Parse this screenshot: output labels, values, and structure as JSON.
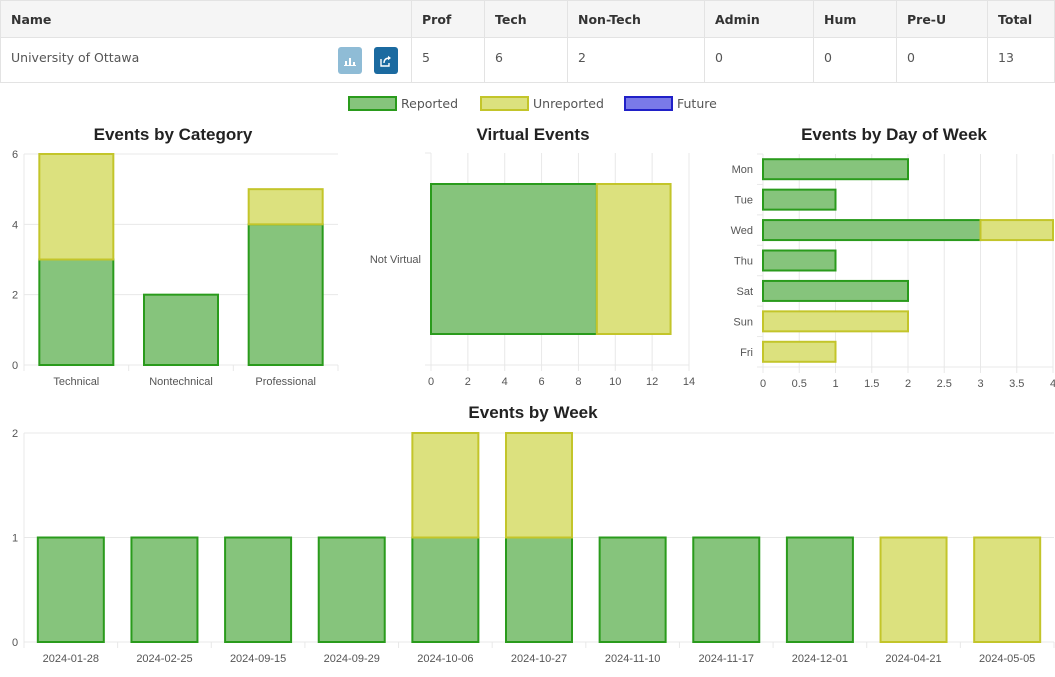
{
  "table": {
    "headers": [
      "Name",
      "Prof",
      "Tech",
      "Non-Tech",
      "Admin",
      "Hum",
      "Pre-U",
      "Total"
    ],
    "row": {
      "name": "University of Ottawa",
      "values": [
        "5",
        "6",
        "2",
        "0",
        "0",
        "0",
        "13"
      ]
    },
    "buttons": {
      "chart_icon": "bar-chart-icon",
      "share_icon": "share-icon"
    }
  },
  "legend": [
    {
      "label": "Reported",
      "fill": "#86c47c",
      "stroke": "#2a9b1c"
    },
    {
      "label": "Unreported",
      "fill": "#dce17e",
      "stroke": "#c3c52a"
    },
    {
      "label": "Future",
      "fill": "#7a7ae8",
      "stroke": "#2020c8"
    }
  ],
  "chart_data": [
    {
      "type": "bar",
      "title": "Events by Category",
      "orientation": "vertical",
      "stacked": true,
      "categories": [
        "Technical",
        "Nontechnical",
        "Professional"
      ],
      "series": [
        {
          "name": "Reported",
          "values": [
            3,
            2,
            4
          ]
        },
        {
          "name": "Unreported",
          "values": [
            3,
            0,
            1
          ]
        }
      ],
      "ylim": [
        0,
        6
      ],
      "yticks": [
        0,
        2,
        4,
        6
      ]
    },
    {
      "type": "bar",
      "title": "Virtual Events",
      "orientation": "horizontal",
      "stacked": true,
      "categories": [
        "Not Virtual"
      ],
      "series": [
        {
          "name": "Reported",
          "values": [
            9
          ]
        },
        {
          "name": "Unreported",
          "values": [
            4
          ]
        }
      ],
      "xlim": [
        0,
        14
      ],
      "xticks": [
        0,
        2,
        4,
        6,
        8,
        10,
        12,
        14
      ]
    },
    {
      "type": "bar",
      "title": "Events by Day of Week",
      "orientation": "horizontal",
      "stacked": true,
      "categories": [
        "Mon",
        "Tue",
        "Wed",
        "Thu",
        "Sat",
        "Sun",
        "Fri"
      ],
      "series": [
        {
          "name": "Reported",
          "values": [
            2,
            1,
            3,
            1,
            2,
            0,
            0
          ]
        },
        {
          "name": "Unreported",
          "values": [
            0,
            0,
            1,
            0,
            0,
            2,
            1
          ]
        }
      ],
      "xlim": [
        0,
        4
      ],
      "xticks": [
        0,
        0.5,
        1,
        1.5,
        2,
        2.5,
        3,
        3.5,
        4
      ]
    },
    {
      "type": "bar",
      "title": "Events by Week",
      "orientation": "vertical",
      "stacked": true,
      "categories": [
        "2024-01-28",
        "2024-02-25",
        "2024-09-15",
        "2024-09-29",
        "2024-10-06",
        "2024-10-27",
        "2024-11-10",
        "2024-11-17",
        "2024-12-01",
        "2024-04-21",
        "2024-05-05"
      ],
      "series": [
        {
          "name": "Reported",
          "values": [
            1,
            1,
            1,
            1,
            1,
            1,
            1,
            1,
            1,
            0,
            0
          ]
        },
        {
          "name": "Unreported",
          "values": [
            0,
            0,
            0,
            0,
            1,
            1,
            0,
            0,
            0,
            1,
            1
          ]
        }
      ],
      "ylim": [
        0,
        2
      ],
      "yticks": [
        0,
        1,
        2
      ]
    }
  ]
}
